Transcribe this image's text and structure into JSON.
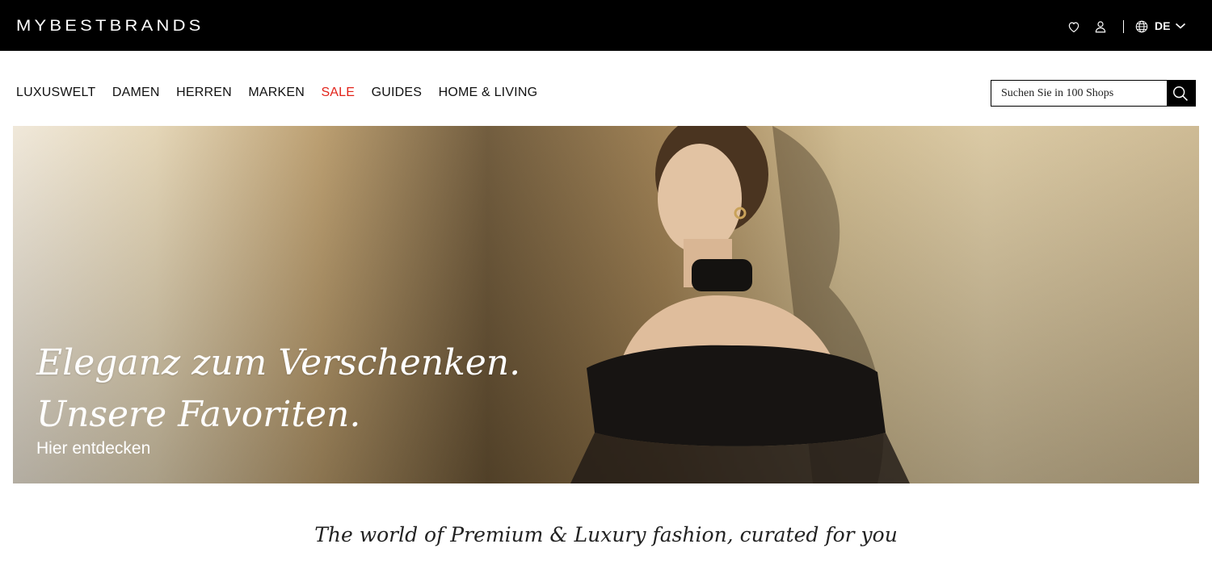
{
  "header": {
    "logo_text": "MYBESTBRANDS",
    "language": "DE",
    "icons": [
      "heart-icon",
      "user-icon",
      "globe-icon",
      "chevron-down-icon"
    ]
  },
  "nav": {
    "items": [
      {
        "label": "LUXUSWELT"
      },
      {
        "label": "DAMEN"
      },
      {
        "label": "HERREN"
      },
      {
        "label": "MARKEN"
      },
      {
        "label": "SALE"
      },
      {
        "label": "GUIDES"
      },
      {
        "label": "HOME & LIVING"
      }
    ],
    "sale_color": "#e2231a"
  },
  "search": {
    "placeholder": "Suchen Sie in 100 Shops"
  },
  "hero": {
    "headline_line1": "Eleganz zum Verschenken.",
    "headline_line2": "Unsere Favoriten.",
    "cta": "Hier entdecken"
  },
  "tagline": "The world of Premium & Luxury fashion, curated for you",
  "colors": {
    "topbar": "#000000",
    "accent_sale": "#e2231a"
  }
}
